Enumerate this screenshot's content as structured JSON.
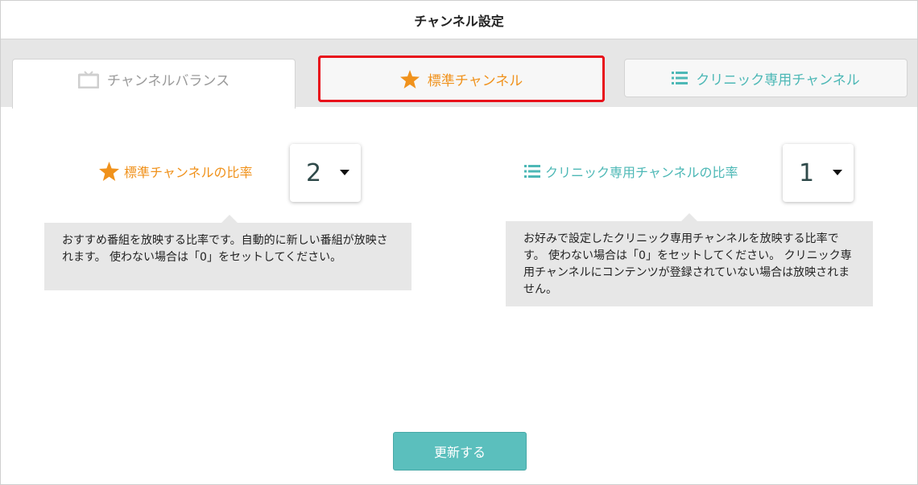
{
  "header": {
    "title": "チャンネル設定"
  },
  "tabs": [
    {
      "label": "チャンネルバランス",
      "icon": "tv-icon",
      "color": "#9a9a9a"
    },
    {
      "label": "標準チャンネル",
      "icon": "star-icon",
      "color": "#f0921c"
    },
    {
      "label": "クリニック専用チャンネル",
      "icon": "list-icon",
      "color": "#4db8b6"
    }
  ],
  "standard": {
    "label": "標準チャンネルの比率",
    "value": "2",
    "description": "おすすめ番組を放映する比率です。自動的に新しい番組が放映されます。 使わない場合は「0」をセットしてください。"
  },
  "clinic": {
    "label": "クリニック専用チャンネルの比率",
    "value": "1",
    "description": "お好みで設定したクリニック専用チャンネルを放映する比率です。 使わない場合は「0」をセットしてください。 クリニック専用チャンネルにコンテンツが登録されていない場合は放映されません。"
  },
  "actions": {
    "update_label": "更新する"
  },
  "colors": {
    "accent_orange": "#f0921c",
    "accent_teal": "#4db8b6",
    "highlight_red": "#e8111b",
    "button_teal": "#5bbfbd"
  }
}
